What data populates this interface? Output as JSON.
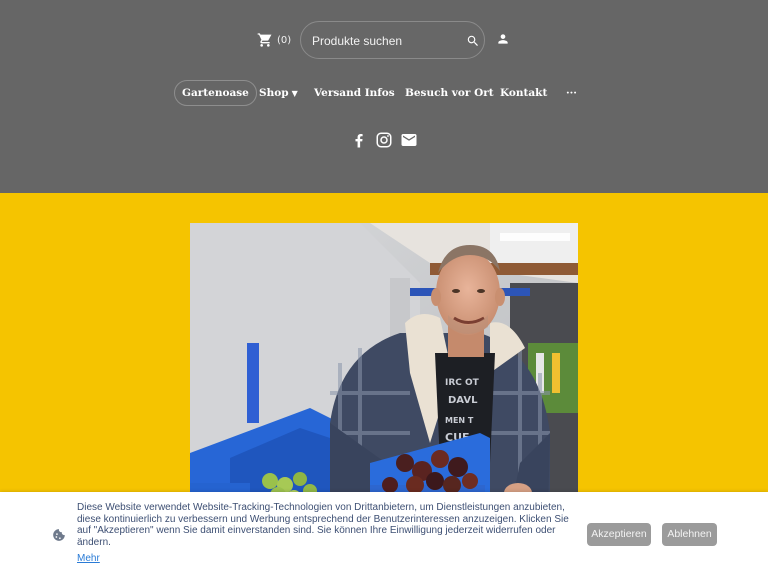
{
  "header": {
    "cart_count": "(0)",
    "search_placeholder": "Produkte suchen",
    "background_color": "#666666"
  },
  "nav": {
    "items": [
      {
        "label": "Gartenoase",
        "active": true
      },
      {
        "label": "Shop",
        "has_dropdown": true
      },
      {
        "label": "Versand Infos"
      },
      {
        "label": "Besuch vor Ort"
      },
      {
        "label": "Kontakt"
      },
      {
        "label": "···"
      }
    ]
  },
  "social": [
    "facebook-icon",
    "instagram-icon",
    "mail-icon"
  ],
  "hero": {
    "background_color": "#f5c400",
    "image": "Man smiling, holding a blue crate of dark tomatoes in a storage room"
  },
  "cookie": {
    "text": "Diese Website verwendet Website-Tracking-Technologien von Drittanbietern, um Dienstleistungen anzubieten, diese kontinuierlich zu verbessern und Werbung entsprechend der Benutzerinteressen anzuzeigen. Klicken Sie auf \"Akzeptieren\" wenn Sie damit einverstanden sind. Sie können Ihre Einwilligung jederzeit widerrufen oder ändern.",
    "more_label": "Mehr",
    "accept_label": "Akzeptieren",
    "decline_label": "Ablehnen"
  }
}
